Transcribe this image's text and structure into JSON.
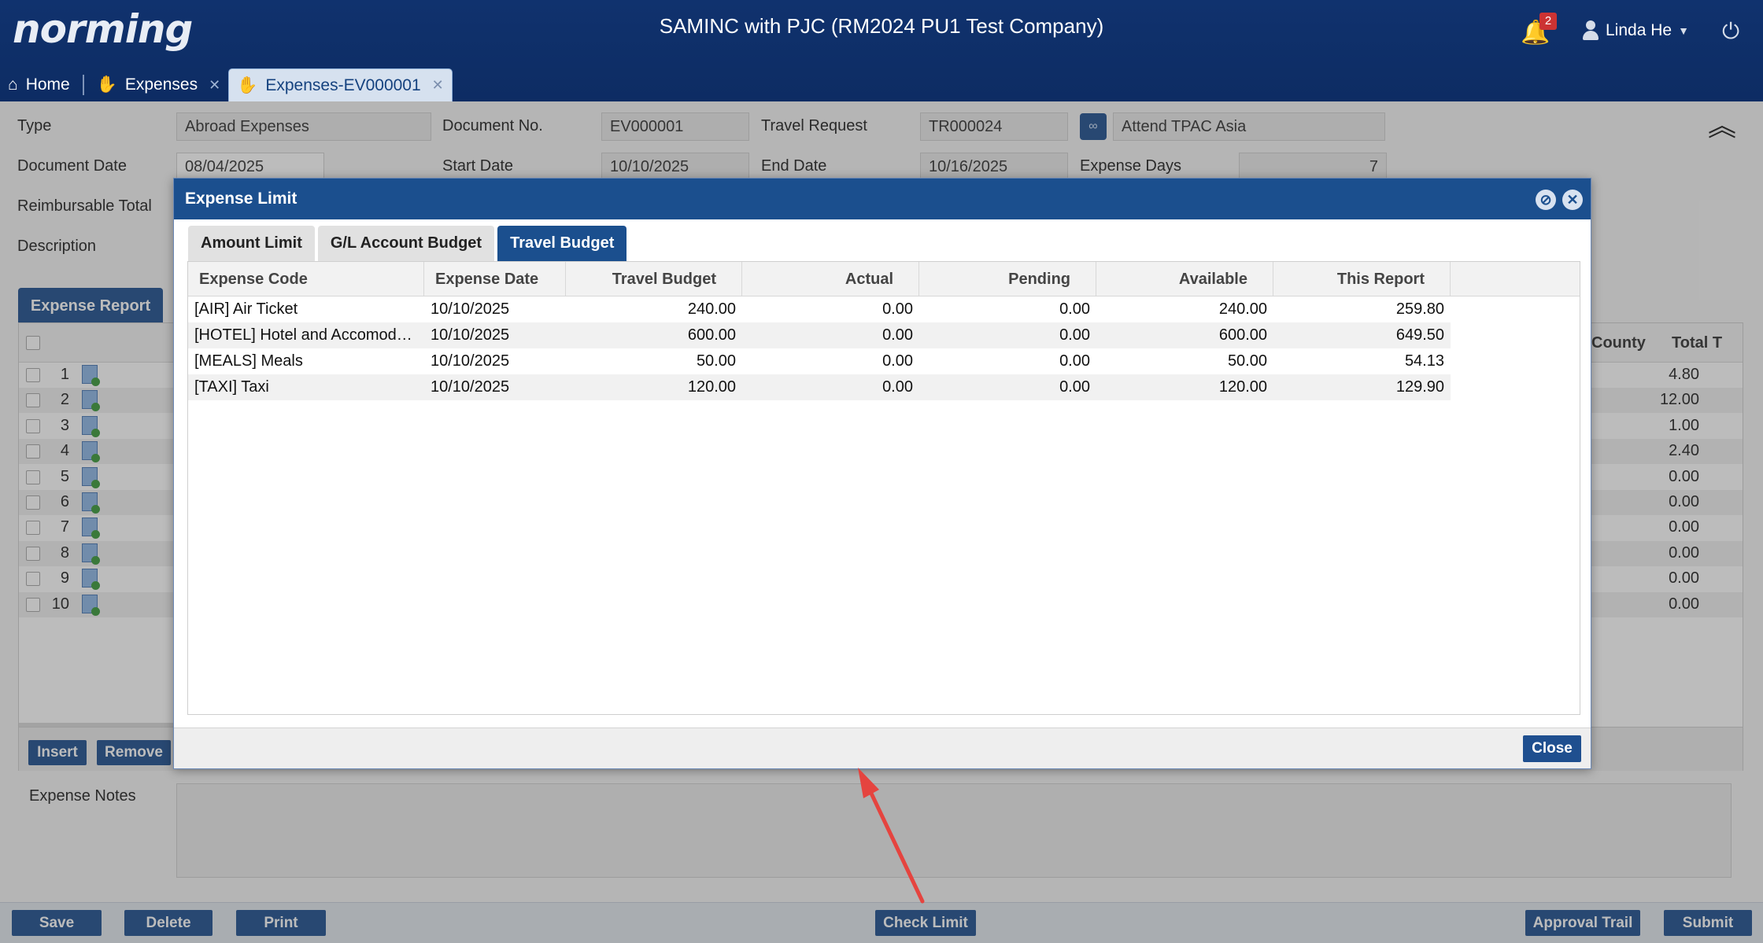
{
  "header": {
    "logo": "norming",
    "title": "SAMINC with PJC (RM2024 PU1 Test Company)",
    "notification_count": "2",
    "user_name": "Linda He"
  },
  "tabs": [
    {
      "label": "Home"
    },
    {
      "label": "Expenses"
    },
    {
      "label": "Expenses-EV000001"
    }
  ],
  "form": {
    "type_label": "Type",
    "type_value": "Abroad Expenses",
    "docno_label": "Document No.",
    "docno_value": "EV000001",
    "travel_req_label": "Travel Request",
    "travel_req_value": "TR000024",
    "travel_req_desc": "Attend TPAC Asia",
    "docdate_label": "Document Date",
    "docdate_value": "08/04/2025",
    "start_label": "Start Date",
    "start_value": "10/10/2025",
    "end_label": "End Date",
    "end_value": "10/16/2025",
    "days_label": "Expense Days",
    "days_value": "7",
    "reimb_label": "Reimbursable Total",
    "desc_label": "Description"
  },
  "grid": {
    "tab_label": "Expense Report",
    "county_header": "County",
    "total_header": "Total T",
    "rows": [
      {
        "num": "1",
        "county": "4.80"
      },
      {
        "num": "2",
        "county": "12.00"
      },
      {
        "num": "3",
        "county": "1.00"
      },
      {
        "num": "4",
        "county": "2.40"
      },
      {
        "num": "5",
        "county": "0.00"
      },
      {
        "num": "6",
        "county": "0.00"
      },
      {
        "num": "7",
        "county": "0.00"
      },
      {
        "num": "8",
        "county": "0.00"
      },
      {
        "num": "9",
        "county": "0.00"
      },
      {
        "num": "10",
        "county": "0.00"
      }
    ],
    "insert_label": "Insert",
    "remove_label": "Remove"
  },
  "notes_label": "Expense Notes",
  "footer": {
    "save": "Save",
    "delete": "Delete",
    "print": "Print",
    "check_limit": "Check Limit",
    "approval_trail": "Approval Trail",
    "submit": "Submit"
  },
  "modal": {
    "title": "Expense Limit",
    "tabs": [
      "Amount Limit",
      "G/L Account Budget",
      "Travel Budget"
    ],
    "active_tab": "Travel Budget",
    "columns": [
      "Expense Code",
      "Expense Date",
      "Travel Budget",
      "Actual",
      "Pending",
      "Available",
      "This Report"
    ],
    "rows": [
      {
        "code": "[AIR] Air Ticket",
        "date": "10/10/2025",
        "budget": "240.00",
        "actual": "0.00",
        "pending": "0.00",
        "available": "240.00",
        "report": "259.80"
      },
      {
        "code": "[HOTEL] Hotel and Accomodation",
        "date": "10/10/2025",
        "budget": "600.00",
        "actual": "0.00",
        "pending": "0.00",
        "available": "600.00",
        "report": "649.50"
      },
      {
        "code": "[MEALS] Meals",
        "date": "10/10/2025",
        "budget": "50.00",
        "actual": "0.00",
        "pending": "0.00",
        "available": "50.00",
        "report": "54.13"
      },
      {
        "code": "[TAXI] Taxi",
        "date": "10/10/2025",
        "budget": "120.00",
        "actual": "0.00",
        "pending": "0.00",
        "available": "120.00",
        "report": "129.90"
      }
    ],
    "close_label": "Close"
  },
  "colors": {
    "primary": "#1b4f8e",
    "header_bg": "#10326e",
    "annotation_arrow": "#e5443f"
  }
}
